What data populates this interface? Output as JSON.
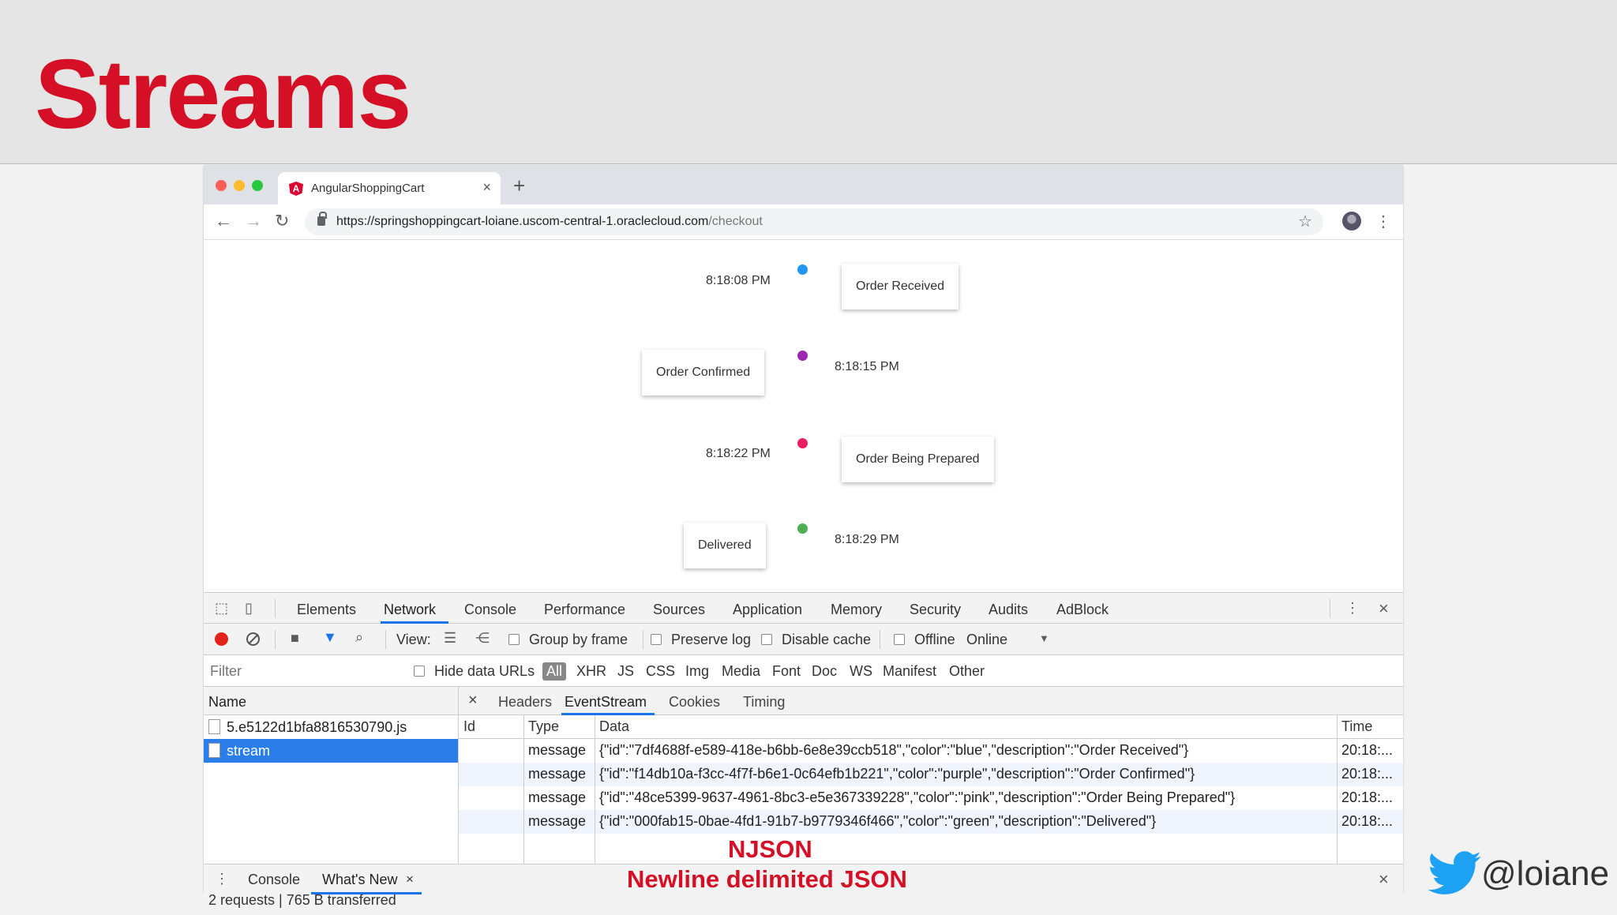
{
  "slide": {
    "title": "Streams",
    "notes": [
      "NJSON",
      "Newline delimited JSON"
    ],
    "twitter_handle": "@loiane",
    "accent": "#d50f25",
    "twitter_color": "#1da1f2"
  },
  "browser": {
    "tab_title": "AngularShoppingCart",
    "tab_favicon": "A",
    "url_host": "https://springshoppingcart-loiane.uscom-central-1.oraclecloud.com",
    "url_path": "/checkout"
  },
  "timeline": [
    {
      "time": "8:18:08 PM",
      "label": "Order Received",
      "color": "#2196f3"
    },
    {
      "time": "8:18:15 PM",
      "label": "Order Confirmed",
      "color": "#9c27b0"
    },
    {
      "time": "8:18:22 PM",
      "label": "Order Being Prepared",
      "color": "#e91e63"
    },
    {
      "time": "8:18:29 PM",
      "label": "Delivered",
      "color": "#4caf50"
    }
  ],
  "devtools": {
    "tabs": [
      "Elements",
      "Network",
      "Console",
      "Performance",
      "Sources",
      "Application",
      "Memory",
      "Security",
      "Audits",
      "AdBlock"
    ],
    "active_tab": "Network",
    "toolbar": {
      "view_label": "View:",
      "group_by_frame": "Group by frame",
      "preserve_log": "Preserve log",
      "disable_cache": "Disable cache",
      "offline": "Offline",
      "throttle": "Online"
    },
    "filter_placeholder": "Filter",
    "hide_data_urls": "Hide data URLs",
    "filter_types": [
      "All",
      "XHR",
      "JS",
      "CSS",
      "Img",
      "Media",
      "Font",
      "Doc",
      "WS",
      "Manifest",
      "Other"
    ],
    "name_header": "Name",
    "requests": [
      "5.e5122d1bfa8816530790.js",
      "stream"
    ],
    "summary": "2 requests | 765 B transferred",
    "detail_tabs": [
      "Headers",
      "EventStream",
      "Cookies",
      "Timing"
    ],
    "columns": [
      "Id",
      "Type",
      "Data",
      "Time"
    ],
    "events": [
      {
        "type": "message",
        "data": "{\"id\":\"7df4688f-e589-418e-b6bb-6e8e39ccb518\",\"color\":\"blue\",\"description\":\"Order Received\"}",
        "time": "20:18:..."
      },
      {
        "type": "message",
        "data": "{\"id\":\"f14db10a-f3cc-4f7f-b6e1-0c64efb1b221\",\"color\":\"purple\",\"description\":\"Order Confirmed\"}",
        "time": "20:18:..."
      },
      {
        "type": "message",
        "data": "{\"id\":\"48ce5399-9637-4961-8bc3-e5e367339228\",\"color\":\"pink\",\"description\":\"Order Being Prepared\"}",
        "time": "20:18:..."
      },
      {
        "type": "message",
        "data": "{\"id\":\"000fab15-0bae-4fd1-91b7-b9779346f466\",\"color\":\"green\",\"description\":\"Delivered\"}",
        "time": "20:18:..."
      }
    ],
    "drawer_tabs": [
      "Console",
      "What's New"
    ]
  }
}
